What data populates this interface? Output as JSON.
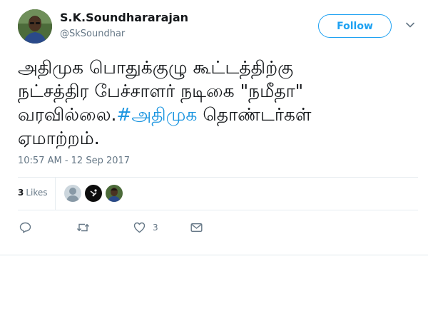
{
  "user": {
    "display_name": "S.K.Soundhararajan",
    "handle": "@SkSoundhar",
    "avatar_icon": "user-avatar-photo"
  },
  "follow_button": {
    "label": "Follow"
  },
  "more_menu": {
    "icon": "chevron-down-icon"
  },
  "tweet": {
    "text_line_1": "அதிமுக பொதுக்குழு கூட்டத்திற்கு",
    "text_line_2": "நட்சத்திர பேச்சாளர் நடிகை \"நமீதா\"",
    "text_line_3_before": "வரவில்லை.",
    "hashtag": "#அதிமுக",
    "text_line_3_after": " தொண்டர்கள்",
    "text_line_4": "ஏமாற்றம்.",
    "hashtag_color": "#1b95e0"
  },
  "timestamp": "10:57 AM - 12 Sep 2017",
  "likes": {
    "count": "3",
    "label": "Likes",
    "likers": [
      "default-avatar-icon",
      "dark-avatar-icon",
      "user-avatar-photo"
    ]
  },
  "actions": {
    "reply_icon": "reply-icon",
    "retweet_icon": "retweet-icon",
    "like_icon": "heart-icon",
    "like_count": "3",
    "message_icon": "envelope-icon"
  },
  "colors": {
    "accent": "#1da1f2",
    "secondary_text": "#657786",
    "divider": "#e6ecf0"
  }
}
